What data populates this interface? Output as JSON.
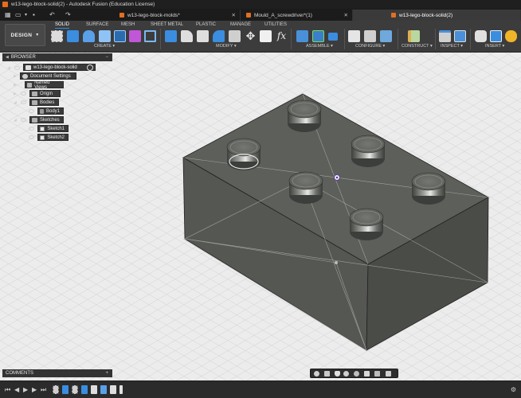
{
  "window": {
    "title": "w13-lego-block-solid(2) - Autodesk Fusion (Education License)"
  },
  "doc_tabs": [
    {
      "label": "w13-lego-block-molds*",
      "active": false
    },
    {
      "label": "Mould_A_screwdriver*(1)",
      "active": false
    },
    {
      "label": "w13-lego-block-solid(2)",
      "active": true
    }
  ],
  "workspace": {
    "label": "DESIGN"
  },
  "toolbar_tabs": [
    "SOLID",
    "SURFACE",
    "MESH",
    "SHEET METAL",
    "PLASTIC",
    "MANAGE",
    "UTILITIES"
  ],
  "tool_groups": {
    "create": "CREATE",
    "modify": "MODIFY",
    "assemble": "ASSEMBLE",
    "configure": "CONFIGURE",
    "construct": "CONSTRUCT",
    "inspect": "INSPECT",
    "insert": "INSERT"
  },
  "browser": {
    "title": "BROWSER",
    "root": "w13-lego-block-solid",
    "items": [
      "Document Settings",
      "Named Views",
      "Origin",
      "Bodies",
      "Body1",
      "Sketches",
      "Sketch1",
      "Sketch2"
    ]
  },
  "comments": {
    "title": "COMMENTS"
  },
  "colors": {
    "accent": "#2f8de4",
    "body": "#5b5d58",
    "viewport": "#ececec",
    "panel": "#3a3a3a"
  }
}
